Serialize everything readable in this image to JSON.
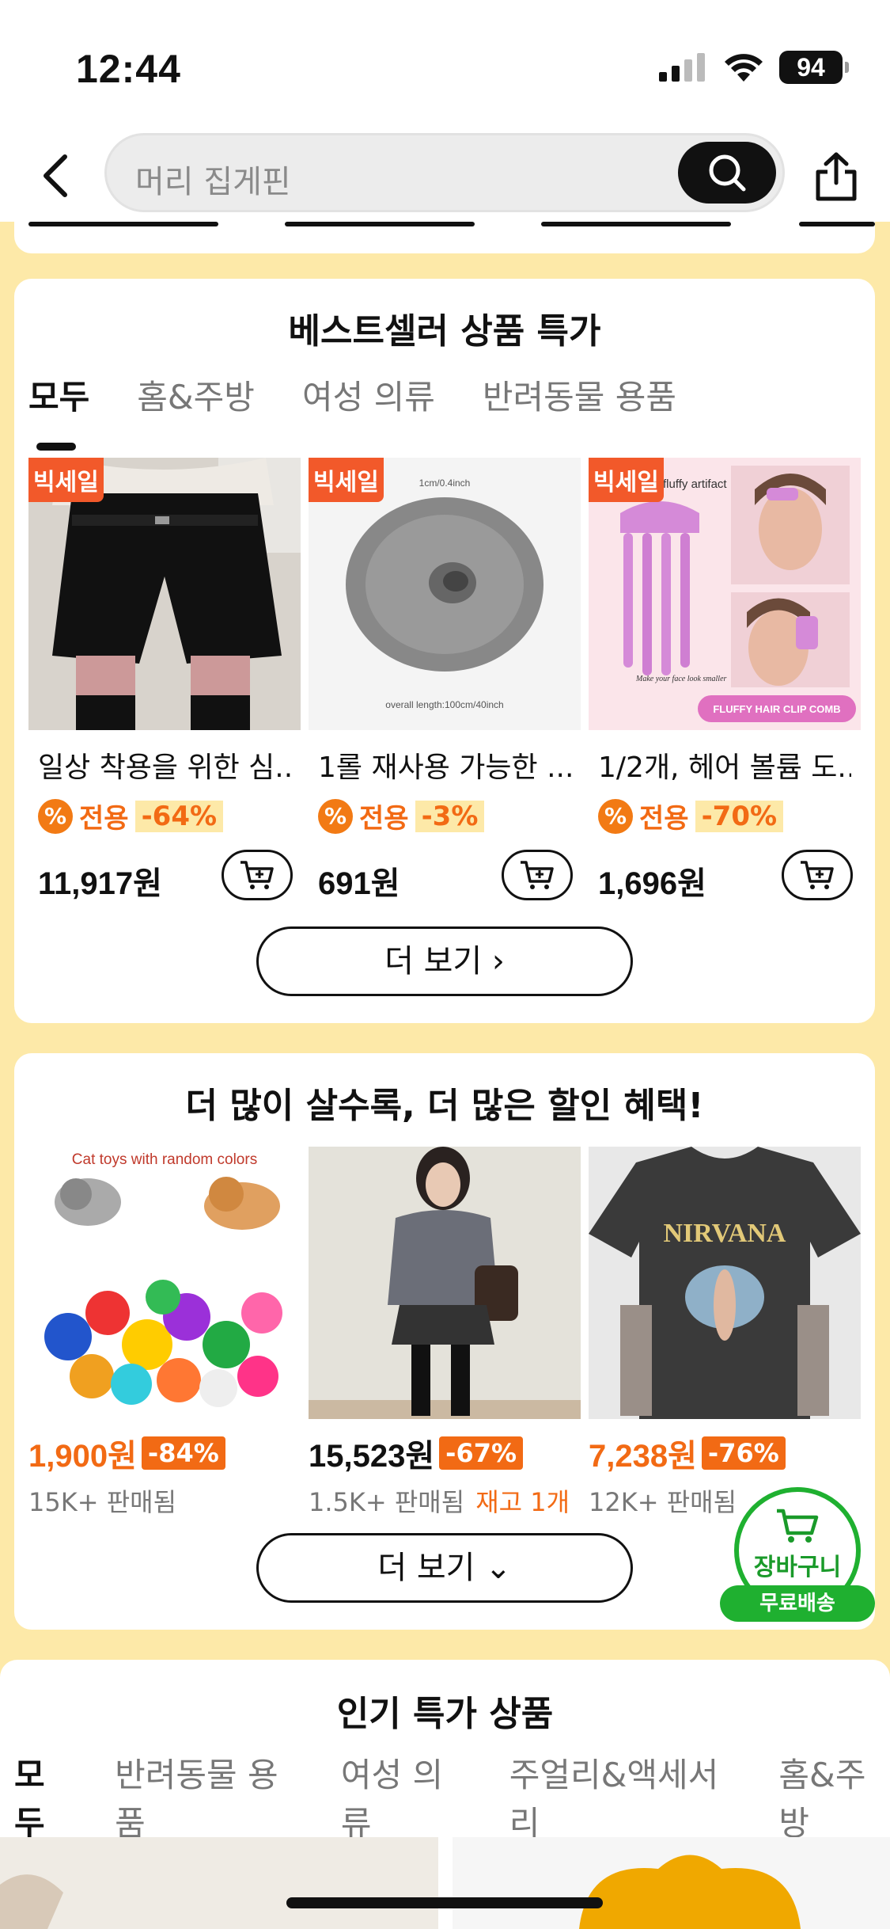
{
  "status": {
    "time": "12:44",
    "battery": "94"
  },
  "search": {
    "placeholder": "머리 집게핀"
  },
  "bestseller": {
    "title": "베스트셀러 상품 특가",
    "tabs": [
      "모두",
      "홈&주방",
      "여성 의류",
      "반려동물 용품"
    ],
    "products": [
      {
        "badge": "빅세일",
        "name": "일상 착용을 위한 심...",
        "promo_label": "전용",
        "promo_pct": "-64%",
        "price": "11,917원"
      },
      {
        "badge": "빅세일",
        "name": "1롤 재사용 가능한 ...",
        "promo_label": "전용",
        "promo_pct": "-3%",
        "price": "691원",
        "img_text_top": "1cm/0.4inch",
        "img_text_bottom": "overall length:100cm/40inch"
      },
      {
        "badge": "빅세일",
        "name": "1/2개, 헤어 볼륨 도...",
        "promo_label": "전용",
        "promo_pct": "-70%",
        "price": "1,696원",
        "img_text_top": "fluffy artifact",
        "img_text_script": "Make your face look smaller",
        "img_text_bottom": "FLUFFY HAIR CLIP COMB"
      }
    ],
    "more_label": "더 보기 ›"
  },
  "bulk_deal": {
    "title": "더 많이 살수록, 더 많은 할인 혜택!",
    "items": [
      {
        "price": "1,900원",
        "pct": "-84%",
        "sold": "15K+ 판매됨",
        "stock": "",
        "img_text": "Cat toys with random colors"
      },
      {
        "price": "15,523원",
        "pct": "-67%",
        "sold": "1.5K+ 판매됨",
        "stock": "재고 1개"
      },
      {
        "price": "7,238원",
        "pct": "-76%",
        "sold": "12K+ 판매됨",
        "stock": "",
        "img_text": "NIRVANA"
      }
    ],
    "more_label": "더 보기 ⌄"
  },
  "popular": {
    "title": "인기 특가 상품",
    "tabs": [
      "모두",
      "반려동물 용품",
      "여성 의류",
      "주얼리&액세서리",
      "홈&주방"
    ]
  },
  "float_cart": {
    "label": "장바구니",
    "shipping": "무료배송"
  },
  "colors": {
    "accent": "#f26a14",
    "badge": "#f2592a",
    "green": "#1fb030",
    "background": "#fde9a8"
  }
}
